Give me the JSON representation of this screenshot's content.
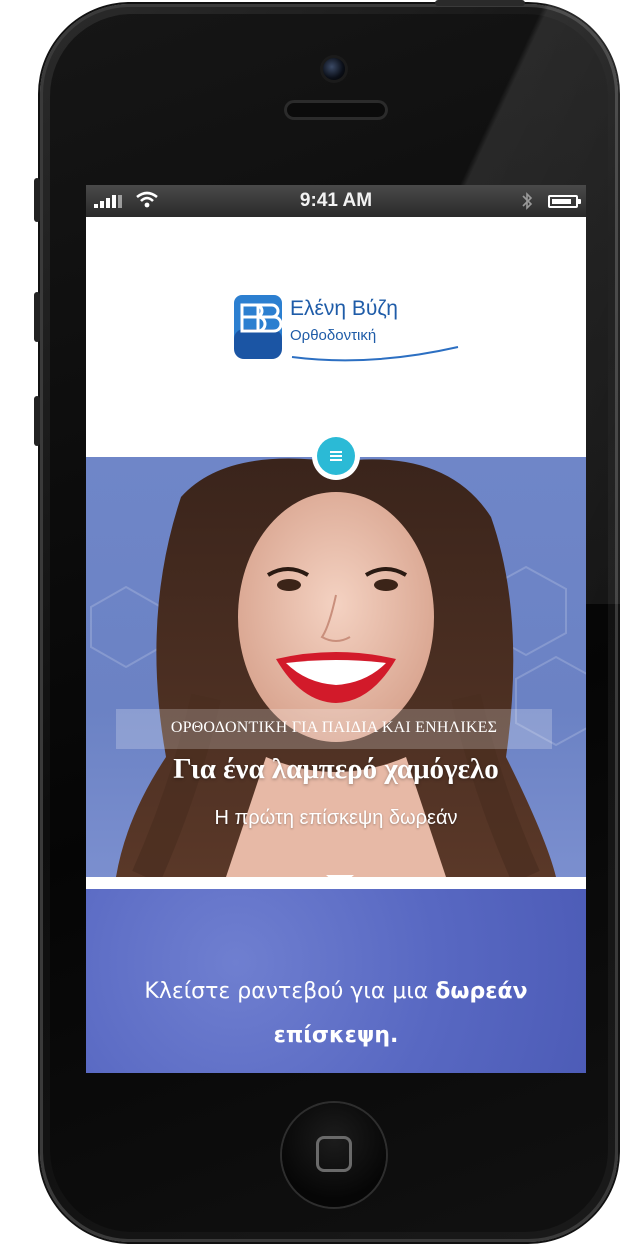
{
  "status_bar": {
    "time": "9:41 AM",
    "signal_bars": 4,
    "battery_level": 0.85,
    "icons": [
      "signal-icon",
      "wifi-icon",
      "bluetooth-icon",
      "battery-icon"
    ]
  },
  "header": {
    "logo_name": "Ελένη Βύζη",
    "logo_subtitle": "Ορθοδοντική",
    "menu_icon": "hamburger-menu-icon"
  },
  "hero": {
    "tagline": "ΟΡΘΟΔΟΝΤΙΚΗ ΓΙΑ ΠΑΙΔΙΑ ΚΑΙ ΕΝΗΛΙΚΕΣ",
    "title": "Για ένα λαμπερό χαμόγελο",
    "subtitle": "Η πρώτη επίσκεψη δωρεάν"
  },
  "cta": {
    "text_before": "Κλείστε ραντεβού για μια ",
    "text_bold": "δωρεάν",
    "text_bold_line2": "επίσκεψη."
  },
  "colors": {
    "brand_blue": "#1f5ca8",
    "menu_teal": "#2bbad6",
    "hero_bg": "#6f86c8",
    "cta_bg": "#5868c2"
  }
}
